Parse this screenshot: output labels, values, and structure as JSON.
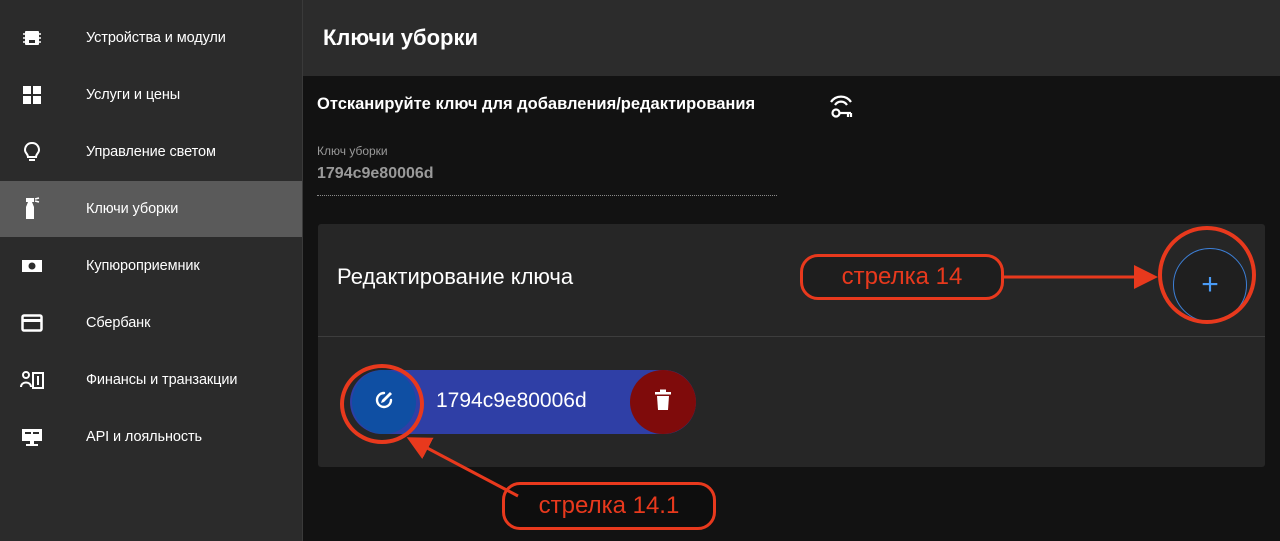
{
  "sidebar": {
    "items": [
      {
        "label": "Устройства и модули",
        "icon": "chip-icon",
        "active": false
      },
      {
        "label": "Услуги и цены",
        "icon": "grid-icon",
        "active": false
      },
      {
        "label": "Управление светом",
        "icon": "lightbulb-icon",
        "active": false
      },
      {
        "label": "Ключи уборки",
        "icon": "spray-bottle-icon",
        "active": true
      },
      {
        "label": "Купюроприемник",
        "icon": "banknote-icon",
        "active": false
      },
      {
        "label": "Сбербанк",
        "icon": "credit-card-icon",
        "active": false
      },
      {
        "label": "Финансы и транзакции",
        "icon": "finance-icon",
        "active": false
      },
      {
        "label": "API и лояльность",
        "icon": "monitor-icon",
        "active": false
      }
    ]
  },
  "header": {
    "title": "Ключи уборки"
  },
  "main": {
    "scan_prompt": "Отсканируйте ключ для добавления/редактирования",
    "key_field": {
      "label": "Ключ уборки",
      "value": "1794c9e80006d"
    },
    "card": {
      "title": "Редактирование ключа",
      "add_label": "+",
      "chip_text": "1794c9e80006d"
    }
  },
  "annotations": {
    "arrow_14": "стрелка 14",
    "arrow_14_1": "стрелка 14.1",
    "color": "#e8391d"
  },
  "colors": {
    "sidebar_bg": "#2b2b2b",
    "active_item_bg": "#5a5a5a",
    "chip_bg": "#2f3fa6",
    "edit_btn_bg": "#0f4fa3",
    "delete_btn_bg": "#7f0b0b",
    "add_btn_accent": "#4a9bf5"
  }
}
